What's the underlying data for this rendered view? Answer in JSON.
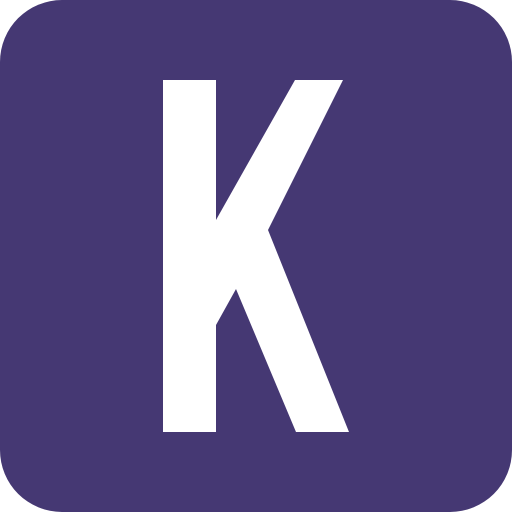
{
  "icon": {
    "letter": "K",
    "background_color": "#453873",
    "letter_color": "#ffffff"
  }
}
